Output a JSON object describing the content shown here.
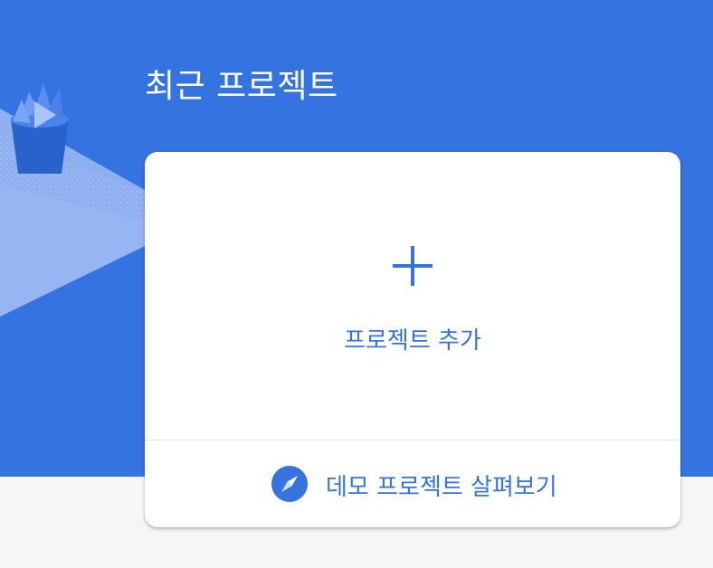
{
  "header": {
    "title": "최근 프로젝트"
  },
  "card": {
    "add_project": {
      "label": "프로젝트 추가",
      "icon": "plus-icon"
    },
    "demo_project": {
      "label": "데모 프로젝트 살펴보기",
      "icon": "compass-icon"
    }
  },
  "colors": {
    "accent": "#3573e1",
    "hero_background": "#3573e1",
    "page_background": "#f5f6f7",
    "card_background": "#ffffff",
    "divider": "#e0e2e5"
  }
}
